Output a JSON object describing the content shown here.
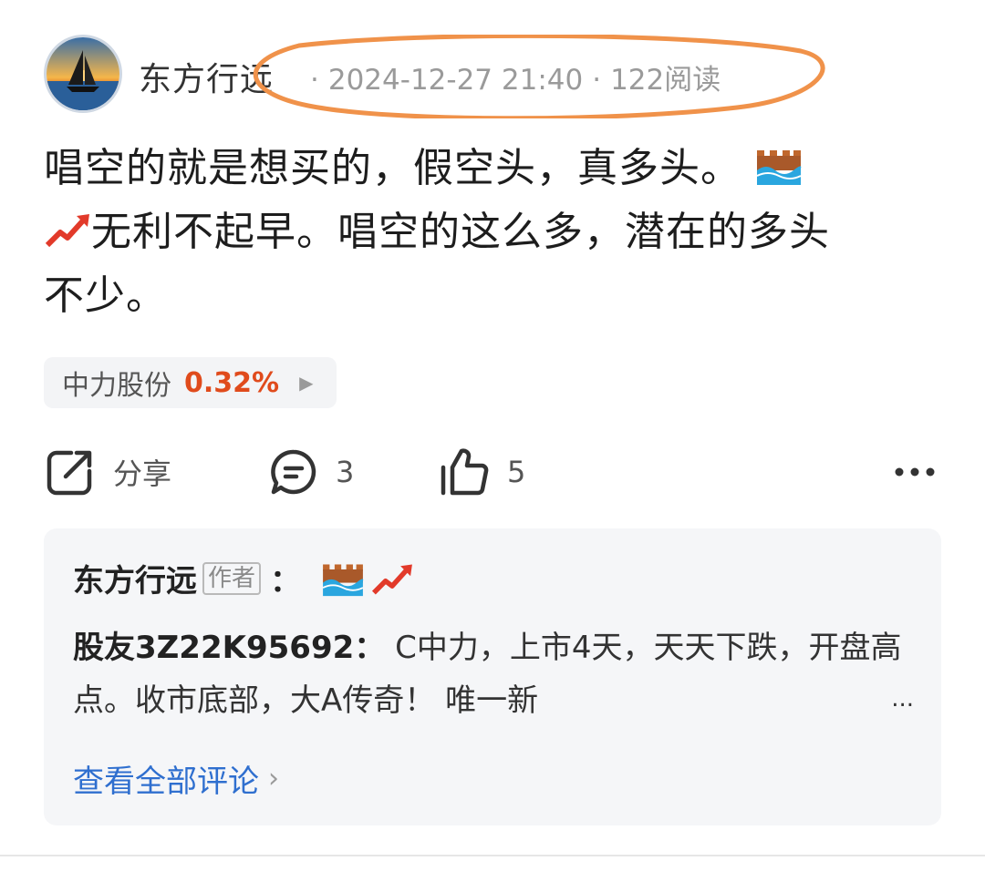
{
  "post": {
    "author": "东方行远",
    "datetime": "2024-12-27 21:40",
    "reads": "122阅读",
    "text_line1": "唱空的就是想买的，假空头，真多头。",
    "text_line2": "无利不起早。唱空的这么多，潜在的多头",
    "text_line3": "不少。"
  },
  "stock": {
    "name": "中力股份",
    "change": "0.32%",
    "change_color": "#e04b1c"
  },
  "actions": {
    "share_label": "分享",
    "comment_count": "3",
    "like_count": "5"
  },
  "comments": {
    "top_author": "东方行远",
    "author_badge": "作者",
    "reply_user": "股友3Z22K95692：",
    "reply_text": "C中力，上市4天，天天下跌，开盘高点。收市底部，大A传奇！ 唯一新",
    "ellipsis": "...",
    "view_all_label": "查看全部评论"
  },
  "colors": {
    "link": "#2f6fcf",
    "annotation_oval": "#f0924a"
  },
  "icons": [
    "avatar-sailboat",
    "wall-emoji",
    "trend-up-emoji",
    "share-icon",
    "comment-icon",
    "like-icon",
    "more-icon",
    "chevron-right-icon"
  ]
}
